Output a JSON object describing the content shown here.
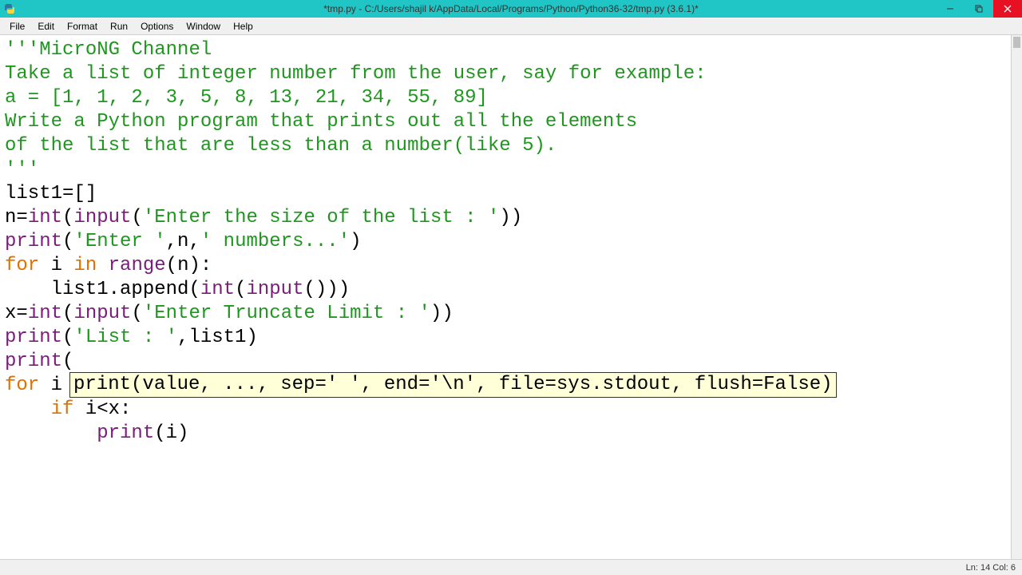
{
  "titlebar": {
    "title": "*tmp.py - C:/Users/shajil k/AppData/Local/Programs/Python/Python36-32/tmp.py (3.6.1)*"
  },
  "menu": {
    "file": "File",
    "edit": "Edit",
    "format": "Format",
    "run": "Run",
    "options": "Options",
    "window": "Window",
    "help": "Help"
  },
  "code": {
    "l1": "'''MicroNG Channel",
    "l2": "Take a list of integer number from the user, say for example:",
    "l3": "a = [1, 1, 2, 3, 5, 8, 13, 21, 34, 55, 89]",
    "l4": "Write a Python program that prints out all the elements",
    "l5": "of the list that are less than a number(like 5).",
    "l6": "'''",
    "l7_a": "list1=[]",
    "l8_a": "n=",
    "l8_b": "int",
    "l8_c": "(",
    "l8_d": "input",
    "l8_e": "(",
    "l8_f": "'Enter the size of the list : '",
    "l8_g": "))",
    "l9_a": "print",
    "l9_b": "(",
    "l9_c": "'Enter '",
    "l9_d": ",n,",
    "l9_e": "' numbers...'",
    "l9_f": ")",
    "l10_a": "for",
    "l10_b": " i ",
    "l10_c": "in",
    "l10_d": " ",
    "l10_e": "range",
    "l10_f": "(n):",
    "l11_a": "    list1.append(",
    "l11_b": "int",
    "l11_c": "(",
    "l11_d": "input",
    "l11_e": "()))",
    "l12_a": "x=",
    "l12_b": "int",
    "l12_c": "(",
    "l12_d": "input",
    "l12_e": "(",
    "l12_f": "'Enter Truncate Limit : '",
    "l12_g": "))",
    "l13_a": "print",
    "l13_b": "(",
    "l13_c": "'List : '",
    "l13_d": ",list1)",
    "l14_a": "print",
    "l14_b": "(",
    "l15_a": "for",
    "l15_b": " i ",
    "l16_a": "    ",
    "l16_b": "if",
    "l16_c": " i<x:",
    "l17_a": "        ",
    "l17_b": "print",
    "l17_c": "(i)"
  },
  "tooltip": {
    "text": "print(value, ..., sep=' ', end='\\n', file=sys.stdout, flush=False)"
  },
  "status": {
    "text": "Ln: 14  Col: 6"
  }
}
